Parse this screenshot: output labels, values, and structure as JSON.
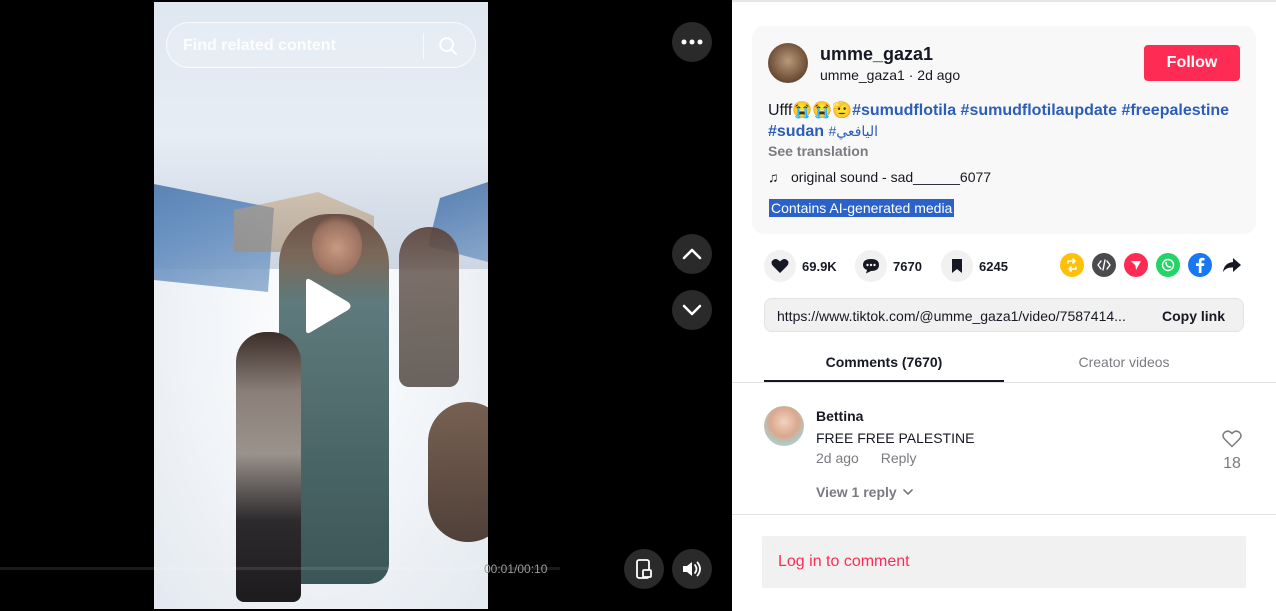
{
  "video": {
    "search_placeholder": "Find related content",
    "time": "00:01/00:10"
  },
  "author": {
    "username": "umme_gaza1",
    "handle": "umme_gaza1",
    "separator": " · ",
    "posted": "2d ago",
    "follow_label": "Follow"
  },
  "caption": {
    "text": "Ufff😭😭🫡",
    "hashtags": [
      "#sumudflotila",
      "#sumudflotilaupdate",
      "#freepalestine",
      "#sudan",
      "#اليافعي"
    ],
    "see_translation": "See translation",
    "sound": "original sound - sad______6077",
    "ai_label": "Contains AI-generated media"
  },
  "stats": {
    "likes": "69.9K",
    "comments": "7670",
    "saves": "6245"
  },
  "share_icons": [
    "repost-icon",
    "embed-icon",
    "send-icon",
    "whatsapp-icon",
    "facebook-icon",
    "share-arrow-icon"
  ],
  "colors": {
    "accent": "#fe2c55",
    "hashtag": "#2b5db9",
    "repost": "#ffc107",
    "embed": "#4a4a4f",
    "send": "#fe2c55",
    "whatsapp": "#25d366",
    "facebook": "#1877f2"
  },
  "link": {
    "url": "https://www.tiktok.com/@umme_gaza1/video/7587414...",
    "copy_label": "Copy link"
  },
  "tabs": [
    {
      "label": "Comments (7670)"
    },
    {
      "label": "Creator videos"
    }
  ],
  "comments": [
    {
      "name": "Bettina",
      "text": "FREE FREE PALESTINE",
      "time": "2d ago",
      "reply_label": "Reply",
      "likes": "18",
      "view_replies": "View 1 reply"
    }
  ],
  "login_prompt": "Log in to comment"
}
